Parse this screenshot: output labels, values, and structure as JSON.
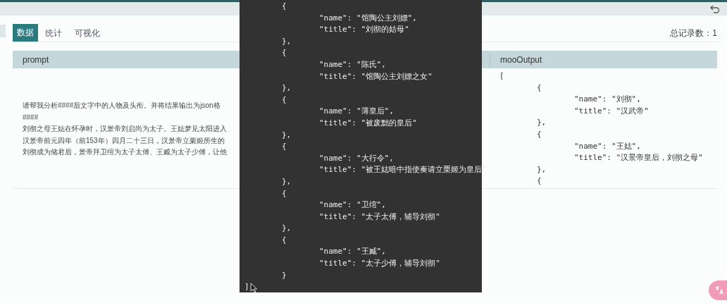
{
  "tabs": [
    {
      "label": "数据",
      "selected": true
    },
    {
      "label": "统计",
      "selected": false
    },
    {
      "label": "可视化",
      "selected": false
    }
  ],
  "record_count": "总记录数：1",
  "table": {
    "columns": [
      "prompt",
      "mooOutput"
    ],
    "rows": [
      {
        "prompt": [
          "请帮我分析####后文字中的人物及头衔。并将结果输出为json格",
          "####",
          "刘彻之母王娡在怀孕时，汉景帝刘启尚为太子。王娡梦见太阳进入",
          "汉景帝前元四年（前153年）四月二十三日，汉景帝立栗姬所生的",
          "刘彻成为储君后，景帝拜卫绾为太子太傅、王臧为太子少傅，让他"
        ],
        "mooOutput": [
          "[",
          "\t{",
          "\t\t\"name\": \"刘彻\",",
          "\t\t\"title\": \"汉武帝\"",
          "\t},",
          "\t{",
          "\t\t\"name\": \"王娡\",",
          "\t\t\"title\": \"汉景帝皇后，刘彻之母\"",
          "\t},",
          "\t{"
        ]
      }
    ]
  },
  "tooltip": {
    "lines": [
      "\t{",
      "\t\t\"name\": \"馆陶公主刘嫖\",",
      "\t\t\"title\": \"刘彻的姑母\"",
      "\t},",
      "\t{",
      "\t\t\"name\": \"陈氏\",",
      "\t\t\"title\": \"馆陶公主刘嫖之女\"",
      "\t},",
      "\t{",
      "\t\t\"name\": \"薄皇后\",",
      "\t\t\"title\": \"被废黜的皇后\"",
      "\t},",
      "\t{",
      "\t\t\"name\": \"大行令\",",
      "\t\t\"title\": \"被王娡暗中指使奏请立栗姬为皇后\"",
      "\t},",
      "\t{",
      "\t\t\"name\": \"卫绾\",",
      "\t\t\"title\": \"太子太傅，辅导刘彻\"",
      "\t},",
      "\t{",
      "\t\t\"name\": \"王臧\",",
      "\t\t\"title\": \"太子少傅，辅导刘彻\"",
      "\t}",
      "]"
    ]
  }
}
